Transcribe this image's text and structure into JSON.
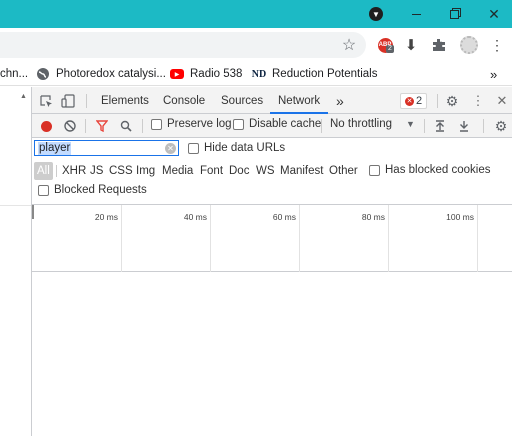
{
  "colors": {
    "titlebar": "#1cbac5",
    "active_tab_underline": "#1a73e8",
    "record": "#d93025",
    "error_badge": "#d93025",
    "filter_red": "#e8453c"
  },
  "window_controls": {
    "profile_icon": "down-arrow-circle-icon",
    "minimize_icon": "minimize-icon",
    "restore_icon": "restore-icon",
    "close_icon": "close-icon"
  },
  "toolbar": {
    "bookmark_star_icon": "star-icon",
    "extensions": [
      {
        "name": "adblock-icon",
        "badge": "2"
      },
      {
        "name": "download-arrow-icon"
      },
      {
        "name": "puzzle-icon"
      },
      {
        "name": "avatar-icon"
      },
      {
        "name": "kebab-menu-icon"
      }
    ]
  },
  "bookmarks": {
    "items": [
      {
        "label": "chn..."
      },
      {
        "label": "Photoredox catalysi..."
      },
      {
        "label": "Radio 538"
      },
      {
        "label": "Reduction Potentials"
      }
    ],
    "overflow": "»"
  },
  "devtools": {
    "tabs": [
      "Elements",
      "Console",
      "Sources",
      "Network"
    ],
    "active_tab": "Network",
    "more_tabs": "»",
    "error_count": "2",
    "controls": {
      "preserve_log": "Preserve log",
      "disable_cache": "Disable cache",
      "throttling": "No throttling",
      "throttling_arrow": "▼"
    },
    "filter": {
      "value": "player",
      "hide_data_urls": "Hide data URLs",
      "types": [
        "All",
        "XHR",
        "JS",
        "CSS",
        "Img",
        "Media",
        "Font",
        "Doc",
        "WS",
        "Manifest",
        "Other"
      ],
      "active_type": "All",
      "has_blocked_cookies": "Has blocked cookies",
      "blocked_requests": "Blocked Requests"
    },
    "timeline": {
      "ticks": [
        "20 ms",
        "40 ms",
        "60 ms",
        "80 ms",
        "100 ms"
      ]
    }
  }
}
